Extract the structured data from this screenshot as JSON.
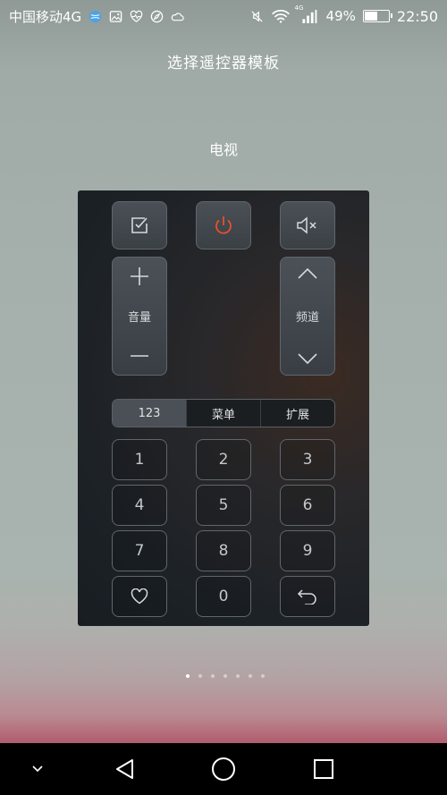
{
  "status_bar": {
    "carrier": "中国移动4G",
    "battery_percent": "49%",
    "battery_level": 0.49,
    "time": "22:50",
    "network_badge": "4G",
    "left_icons": [
      "globe-icon",
      "image-icon",
      "heart-monitor-icon",
      "compass-icon",
      "cloud-icon"
    ],
    "right_icons": [
      "mute-icon",
      "wifi-icon",
      "signal-icon",
      "battery-icon"
    ]
  },
  "header": {
    "title": "选择遥控器模板"
  },
  "device": {
    "name": "电视"
  },
  "remote": {
    "top_buttons": [
      "check-icon",
      "power-icon",
      "mute-icon"
    ],
    "volume": {
      "label": "音量",
      "up_icon": "plus-icon",
      "down_icon": "minus-icon"
    },
    "channel": {
      "label": "频道",
      "up_icon": "chevron-up-icon",
      "down_icon": "chevron-down-icon"
    },
    "tabs": [
      {
        "label": "123",
        "active": true
      },
      {
        "label": "菜单",
        "active": false
      },
      {
        "label": "扩展",
        "active": false
      }
    ],
    "keypad": [
      "1",
      "2",
      "3",
      "4",
      "5",
      "6",
      "7",
      "8",
      "9"
    ],
    "bottom_row": {
      "left_icon": "heart-icon",
      "zero": "0",
      "right_icon": "back-icon"
    },
    "accent_color": "#e5522c"
  },
  "pager": {
    "count": 7,
    "active_index": 0
  },
  "navbar": {
    "buttons": [
      "chevron-down-icon",
      "back-triangle-icon",
      "home-circle-icon",
      "recents-square-icon"
    ]
  }
}
